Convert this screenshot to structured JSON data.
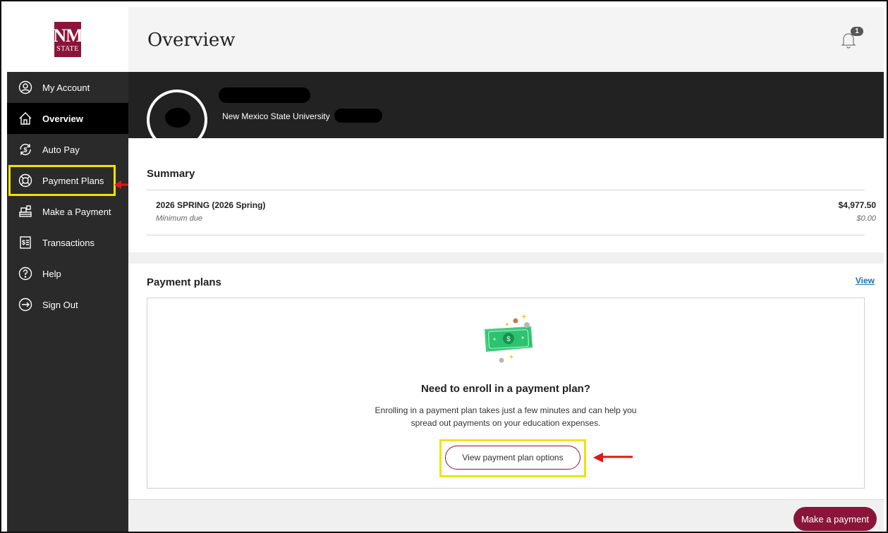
{
  "logo": {
    "line1": "NM",
    "line2": "STATE"
  },
  "header": {
    "title": "Overview",
    "notification_count": "1"
  },
  "sidebar": {
    "items": [
      {
        "label": "My Account",
        "icon": "user-circle-icon"
      },
      {
        "label": "Overview",
        "icon": "home-icon",
        "active": true
      },
      {
        "label": "Auto Pay",
        "icon": "auto-pay-icon"
      },
      {
        "label": "Payment Plans",
        "icon": "lifebuoy-icon",
        "highlighted": true
      },
      {
        "label": "Make a Payment",
        "icon": "cash-register-icon"
      },
      {
        "label": "Transactions",
        "icon": "receipt-icon"
      },
      {
        "label": "Help",
        "icon": "help-circle-icon"
      },
      {
        "label": "Sign Out",
        "icon": "sign-out-icon"
      }
    ]
  },
  "profile": {
    "organization": "New Mexico State University"
  },
  "summary": {
    "title": "Summary",
    "term": "2026 SPRING (2026 Spring)",
    "amount": "$4,977.50",
    "min_label": "Minimum due",
    "min_amount": "$0.00"
  },
  "payment_plans": {
    "title": "Payment plans",
    "view_link": "View",
    "card_title": "Need to enroll in a payment plan?",
    "card_text_1": "Enrolling in a payment plan takes just a few minutes and can help you",
    "card_text_2": "spread out payments on your education expenses.",
    "button": "View payment plan options"
  },
  "footer": {
    "make_payment": "Make a payment"
  },
  "colors": {
    "brand": "#8a1538",
    "highlight": "#f2e200",
    "annotation": "#e01818",
    "link": "#1f6fb0"
  }
}
